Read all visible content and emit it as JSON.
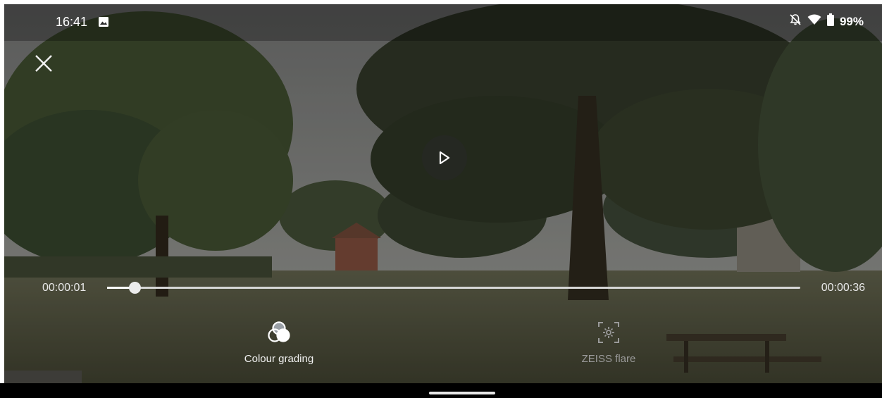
{
  "statusbar": {
    "time": "16:41",
    "battery": "99%",
    "icons": [
      "image-icon",
      "bell-off-icon",
      "wifi-icon",
      "battery-icon"
    ]
  },
  "player": {
    "current_time": "00:00:01",
    "total_time": "00:00:36",
    "progress": 0.04,
    "state": "paused"
  },
  "tools": [
    {
      "label": "Colour grading",
      "icon": "colour-grading-icon",
      "enabled": true
    },
    {
      "label": "ZEISS flare",
      "icon": "zeiss-flare-icon",
      "enabled": false
    }
  ],
  "colors": {
    "accent": "#ffffff",
    "disabled": "#9a9a9a"
  }
}
